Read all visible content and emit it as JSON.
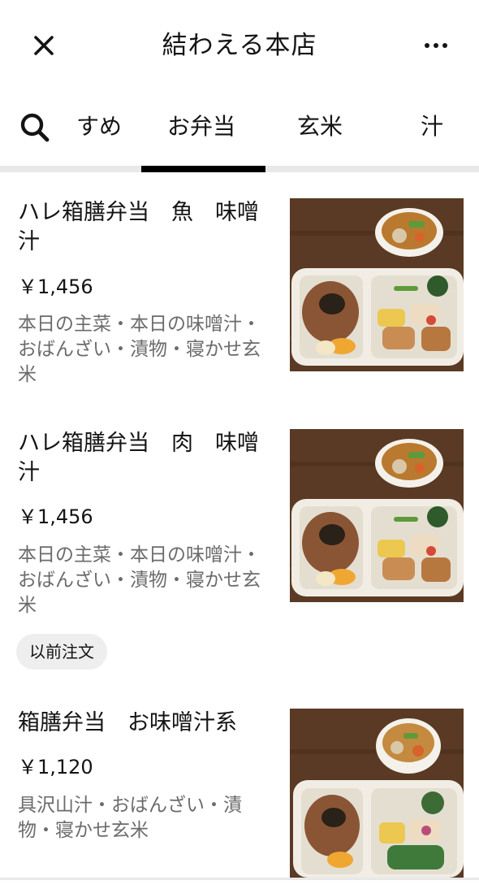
{
  "header": {
    "title": "結わえる本店",
    "close_icon": "close-icon",
    "more_icon": "more-horizontal-icon"
  },
  "tabs": {
    "search_icon": "search-icon",
    "items": [
      {
        "label": "すめ",
        "active": false
      },
      {
        "label": "お弁当",
        "active": true
      },
      {
        "label": "玄米",
        "active": false
      },
      {
        "label": "汁",
        "active": false
      }
    ]
  },
  "menu_items": [
    {
      "name": "ハレ箱膳弁当　魚　味噌汁",
      "price": "￥1,456",
      "description": "本日の主菜・本日の味噌汁・おばんざい・漬物・寝かせ玄米",
      "badge": ""
    },
    {
      "name": "ハレ箱膳弁当　肉　味噌汁",
      "price": "￥1,456",
      "description": "本日の主菜・本日の味噌汁・おばんざい・漬物・寝かせ玄米",
      "badge": "以前注文"
    },
    {
      "name": "箱膳弁当　お味噌汁系",
      "price": "￥1,120",
      "description": "具沢山汁・おばんざい・漬物・寝かせ玄米",
      "badge": ""
    }
  ],
  "colors": {
    "text_primary": "#141414",
    "text_secondary": "#6b6b6b",
    "tab_indicator": "#000000",
    "divider": "#e8e8e8",
    "badge_bg": "#eeeeee"
  }
}
